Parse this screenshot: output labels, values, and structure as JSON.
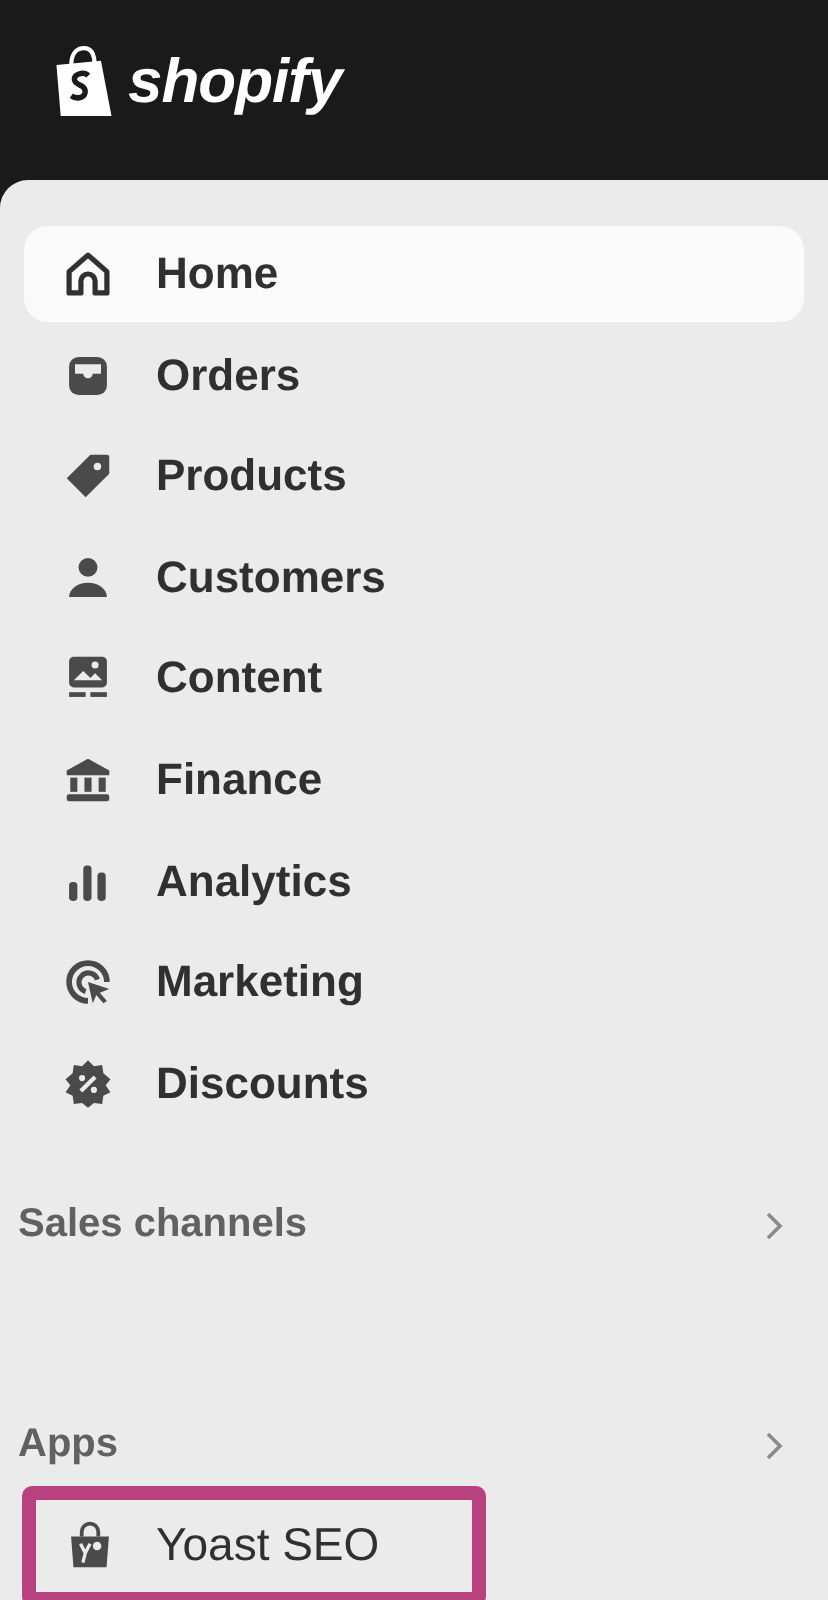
{
  "header": {
    "logo_text": "shopify"
  },
  "nav": [
    {
      "label": "Home",
      "kind": "home",
      "selected": true
    },
    {
      "label": "Orders",
      "kind": "orders",
      "selected": false
    },
    {
      "label": "Products",
      "kind": "products",
      "selected": false
    },
    {
      "label": "Customers",
      "kind": "customers",
      "selected": false
    },
    {
      "label": "Content",
      "kind": "content",
      "selected": false
    },
    {
      "label": "Finance",
      "kind": "finance",
      "selected": false
    },
    {
      "label": "Analytics",
      "kind": "analytics",
      "selected": false
    },
    {
      "label": "Marketing",
      "kind": "marketing",
      "selected": false
    },
    {
      "label": "Discounts",
      "kind": "discounts",
      "selected": false
    }
  ],
  "sections": [
    {
      "title": "Sales channels"
    },
    {
      "title": "Apps",
      "items": [
        {
          "label": "Yoast SEO",
          "kind": "app",
          "highlighted": true
        }
      ]
    }
  ]
}
